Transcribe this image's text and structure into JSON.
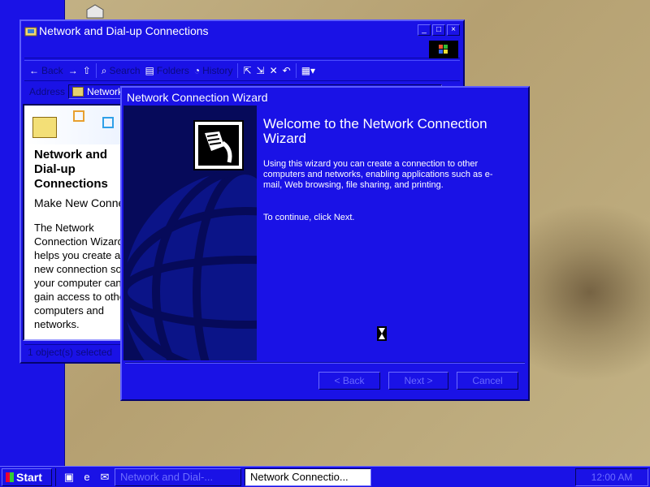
{
  "explorer": {
    "title": "Network and Dial-up Connections",
    "toolbar": {
      "back": "Back",
      "search": "Search",
      "folders": "Folders",
      "history": "History"
    },
    "address_label": "Address",
    "address_value": "Network and Dial-up Connections",
    "panel_title": "Network and Dial-up Connections",
    "panel_subtitle": "Make New Connection",
    "panel_description": "The Network Connection Wizard helps you create a new connection so your computer can gain access to other computers and networks.",
    "status_text": "1 object(s) selected"
  },
  "wizard": {
    "title": "Network Connection Wizard",
    "heading": "Welcome to the Network Connection Wizard",
    "body": "Using this wizard you can create a connection to other computers and networks, enabling applications such as e-mail, Web browsing, file sharing, and printing.",
    "continue_text": "To continue, click Next.",
    "buttons": {
      "back": "< Back",
      "next": "Next >",
      "cancel": "Cancel"
    }
  },
  "taskbar": {
    "start": "Start",
    "tasks": [
      {
        "label": "Network and Dial-...",
        "active": false
      },
      {
        "label": "Network Connectio...",
        "active": true
      }
    ],
    "clock": "12:00 AM"
  },
  "colors": {
    "accent": "#1a12e6",
    "dark": "#060a5a"
  }
}
